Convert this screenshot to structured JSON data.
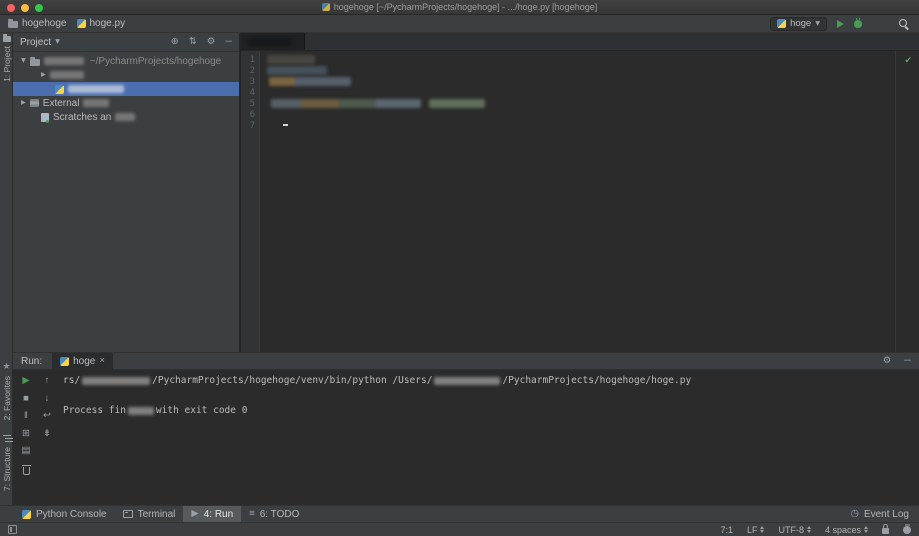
{
  "window": {
    "title": "hogehoge [~/PycharmProjects/hogehoge] - .../hoge.py [hogehoge]"
  },
  "navbar": {
    "crumb_project": "hogehoge",
    "crumb_file": "hoge.py",
    "run_config": "hoge"
  },
  "stripes": {
    "project": "1: Project",
    "favorites": "2: Favorites",
    "structure": "7: Structure"
  },
  "project": {
    "title": "Project",
    "root_path": "~/PycharmProjects/hogehoge",
    "external_label": "External ",
    "scratches_label": "Scratches an"
  },
  "editor": {
    "lines": [
      "1",
      "2",
      "3",
      "4",
      "5",
      "6",
      "7"
    ]
  },
  "run": {
    "label": "Run:",
    "tab": "hoge",
    "console": {
      "l1s1": "rs/",
      "l1s2": "/PycharmProjects/hogehoge/venv/bin/python /Users/",
      "l1s3": "/PycharmProjects/hogehoge/hoge.py",
      "l2s1": "Process fin",
      "l2s2": " with exit code 0"
    }
  },
  "bottombar": {
    "python_console": "Python Console",
    "terminal": "Terminal",
    "run": "4: Run",
    "todo": "6: TODO",
    "event_log": "Event Log"
  },
  "statusbar": {
    "position": "7:1",
    "line_ending": "LF",
    "encoding": "UTF-8",
    "indent": "4 spaces"
  },
  "icons": {
    "play": "▶",
    "stop": "■",
    "pause": "‖",
    "restore": "⊞",
    "print": "▤",
    "up": "↑",
    "down": "↓",
    "softwrap": "↩",
    "scrollend": "⇟",
    "gear": "⚙",
    "minus": "─",
    "chevron_down": "▾",
    "chevron_right": "▸",
    "collapse": "⇅",
    "locate": "⊕",
    "menu": "≡",
    "check": "✔",
    "clock": "◷",
    "close": "×",
    "star": "★"
  },
  "colors": {
    "selection_blue": "#4b6eaf",
    "run_green": "#499c54",
    "panel_bg": "#3c3f41",
    "editor_bg": "#2b2b2b"
  }
}
